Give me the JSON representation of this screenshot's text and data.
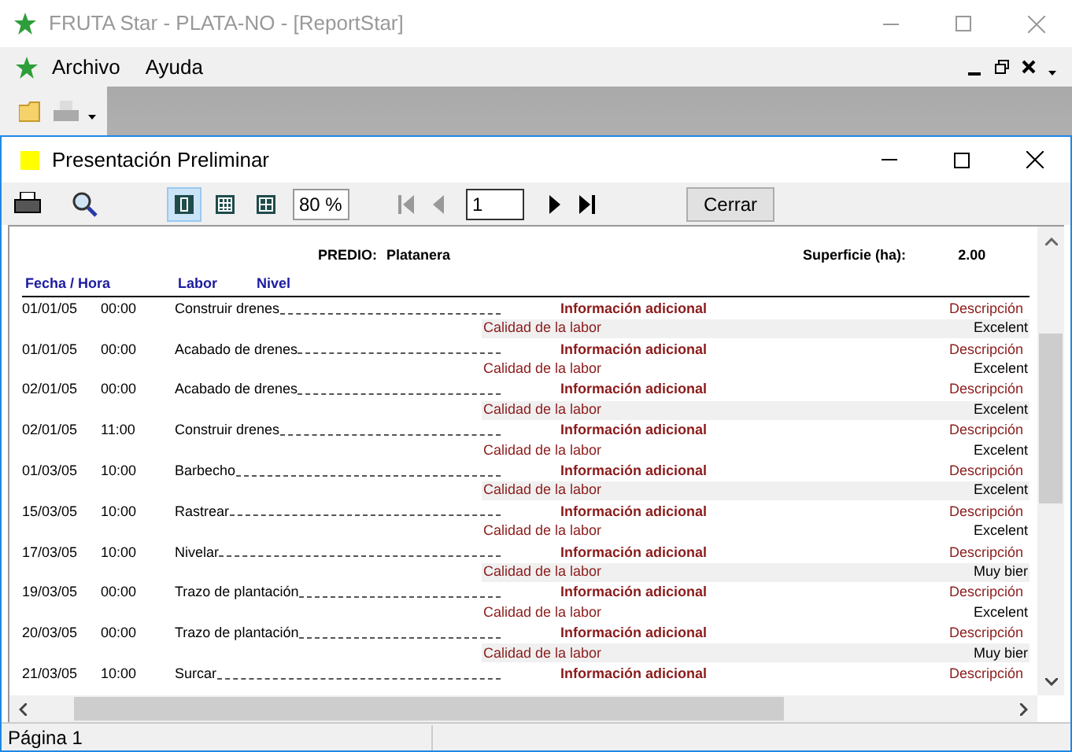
{
  "app_window": {
    "title": "FRUTA Star - PLATA-NO - [ReportStar]"
  },
  "menu": [
    {
      "label": "Archivo"
    },
    {
      "label": "Ayuda"
    }
  ],
  "preview_window": {
    "title": "Presentación Preliminar"
  },
  "preview_toolbar": {
    "view_modes": [
      {
        "selected": true
      },
      {
        "selected": false
      },
      {
        "selected": false
      }
    ],
    "zoom": "80 %",
    "page": "1",
    "close_button": "Cerrar"
  },
  "report": {
    "predio_label": "PREDIO:",
    "predio": "Platanera",
    "superficie_label": "Superficie (ha):",
    "superficie": "2.00",
    "columns": [
      "Fecha / Hora",
      "Labor",
      "Nivel"
    ],
    "rows": [
      {
        "date": "01/01/05",
        "time": "00:00",
        "labor": "Construir drenes",
        "info": "Información adicional",
        "descr": "Descripción",
        "quality_label": "Calidad de la labor",
        "quality": "Excelent"
      },
      {
        "date": "01/01/05",
        "time": "00:00",
        "labor": "Acabado de drenes",
        "info": "Información adicional",
        "descr": "Descripción",
        "quality_label": "Calidad de la labor",
        "quality": "Excelent"
      },
      {
        "date": "02/01/05",
        "time": "00:00",
        "labor": "Acabado de drenes",
        "info": "Información adicional",
        "descr": "Descripción",
        "quality_label": "Calidad de la labor",
        "quality": "Excelent"
      },
      {
        "date": "02/01/05",
        "time": "11:00",
        "labor": "Construir drenes",
        "info": "Información adicional",
        "descr": "Descripción",
        "quality_label": "Calidad de la labor",
        "quality": "Excelent"
      },
      {
        "date": "01/03/05",
        "time": "10:00",
        "labor": "Barbecho",
        "info": "Información adicional",
        "descr": "Descripción",
        "quality_label": "Calidad de la labor",
        "quality": "Excelent"
      },
      {
        "date": "15/03/05",
        "time": "10:00",
        "labor": "Rastrear",
        "info": "Información adicional",
        "descr": "Descripción",
        "quality_label": "Calidad de la labor",
        "quality": "Excelent"
      },
      {
        "date": "17/03/05",
        "time": "10:00",
        "labor": "Nivelar",
        "info": "Información adicional",
        "descr": "Descripción",
        "quality_label": "Calidad de la labor",
        "quality": "Muy bier"
      },
      {
        "date": "19/03/05",
        "time": "00:00",
        "labor": "Trazo de plantación",
        "info": "Información adicional",
        "descr": "Descripción",
        "quality_label": "Calidad de la labor",
        "quality": "Excelent"
      },
      {
        "date": "20/03/05",
        "time": "00:00",
        "labor": "Trazo de plantación",
        "info": "Información adicional",
        "descr": "Descripción",
        "quality_label": "Calidad de la labor",
        "quality": "Muy bier"
      },
      {
        "date": "21/03/05",
        "time": "10:00",
        "labor": "Surcar",
        "info": "Información adicional",
        "descr": "Descripción"
      }
    ]
  },
  "status_bar": {
    "text": "Página 1"
  }
}
